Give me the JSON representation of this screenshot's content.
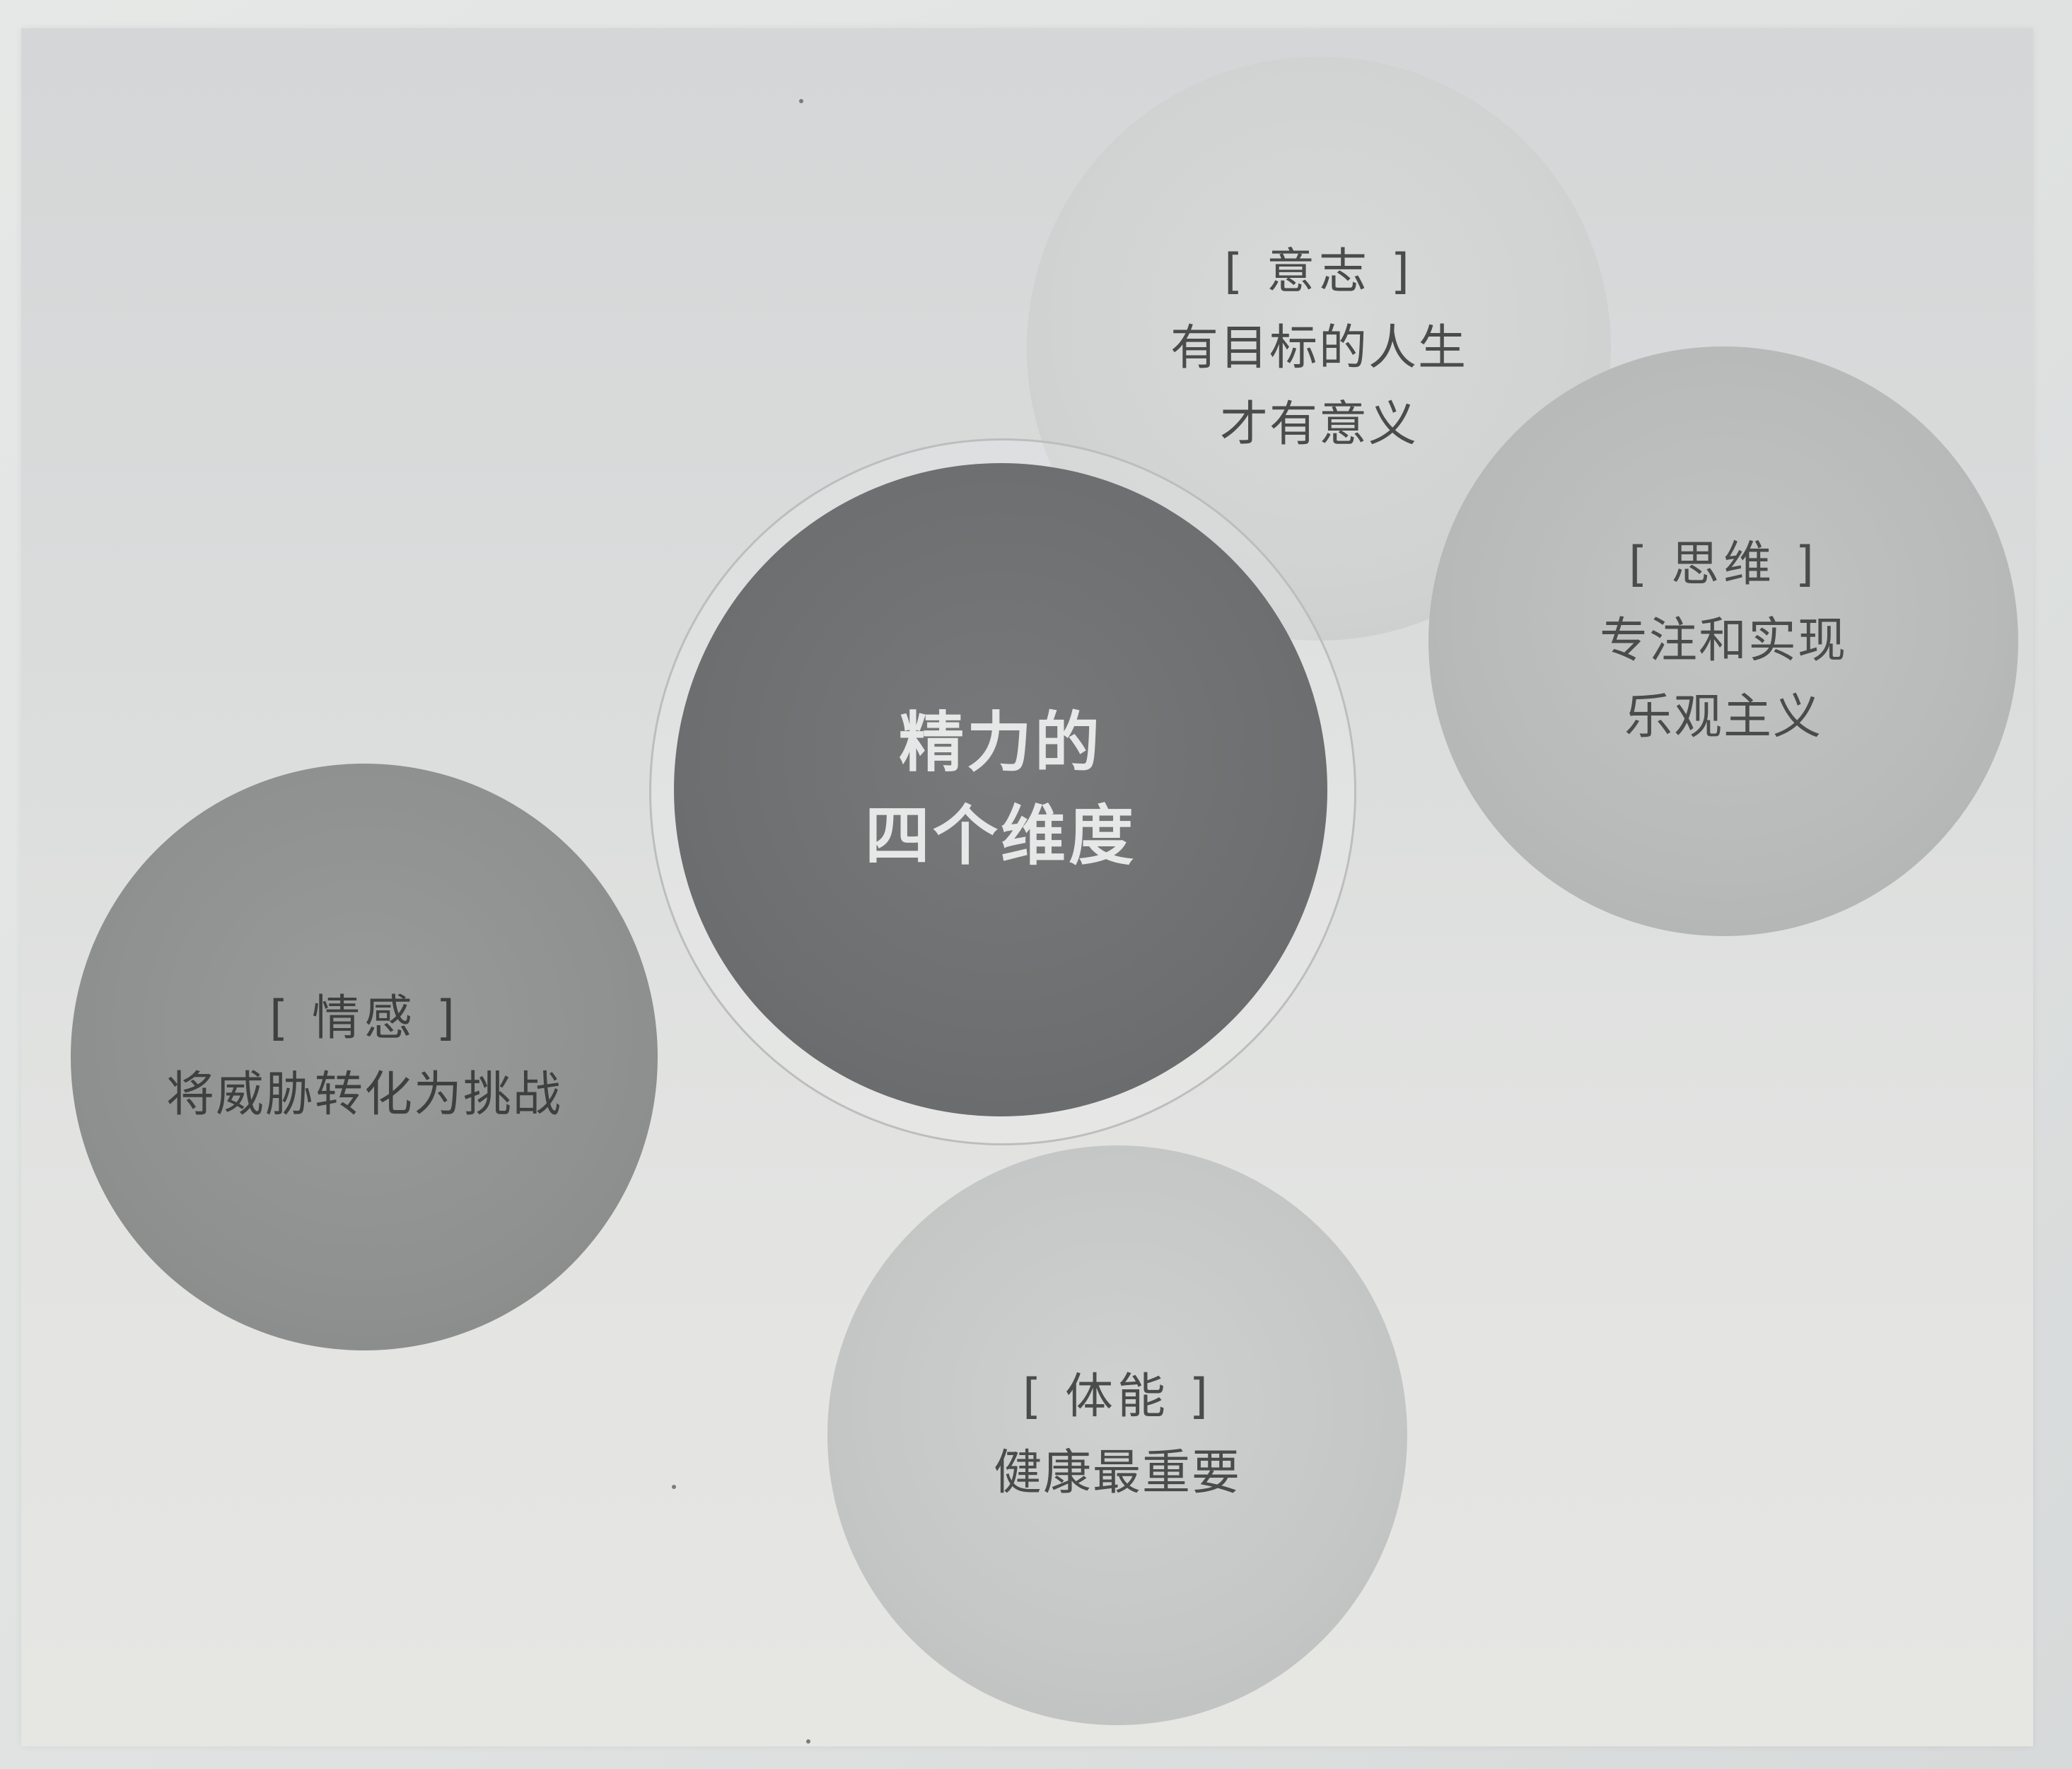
{
  "center": {
    "line1": "精力的",
    "line2": "四个维度"
  },
  "will": {
    "heading": "[ 意志 ]",
    "line1": "有目标的人生",
    "line2": "才有意义"
  },
  "mind": {
    "heading": "[ 思维 ]",
    "line1": "专注和实现",
    "line2": "乐观主义"
  },
  "emotion": {
    "heading": "[ 情感 ]",
    "line1": "将威胁转化为挑战"
  },
  "physical": {
    "heading": "[ 体能 ]",
    "line1": "健康最重要"
  }
}
